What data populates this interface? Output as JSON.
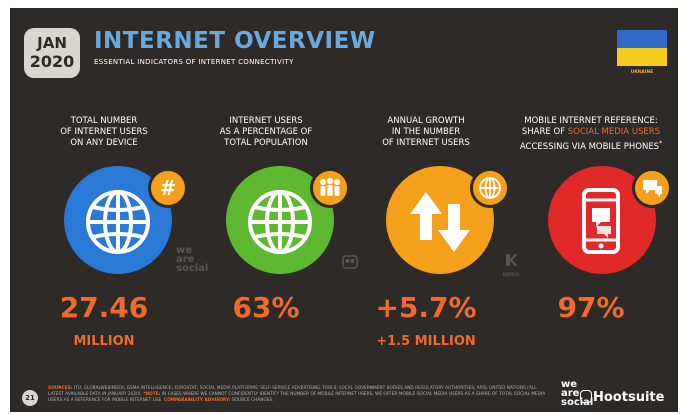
{
  "header": {
    "month": "JAN",
    "year": "2020",
    "title": "INTERNET OVERVIEW",
    "subtitle": "ESSENTIAL INDICATORS OF INTERNET CONNECTIVITY",
    "country": "UKRAINE",
    "flag_colors": [
      "#2f6bc8",
      "#f4cd1c"
    ]
  },
  "metrics": [
    {
      "heading_lines": [
        "TOTAL NUMBER",
        "OF INTERNET USERS",
        "ON ANY DEVICE"
      ],
      "value": "27.46",
      "unit": "MILLION",
      "color": "#2a79d6",
      "icon": "globe-icon",
      "badge_icon": "hashtag-icon"
    },
    {
      "heading_lines": [
        "INTERNET USERS",
        "AS A PERCENTAGE OF",
        "TOTAL POPULATION"
      ],
      "value": "63%",
      "unit": "",
      "color": "#5eb930",
      "icon": "globe-icon",
      "badge_icon": "people-icon"
    },
    {
      "heading_lines": [
        "ANNUAL GROWTH",
        "IN THE NUMBER",
        "OF INTERNET USERS"
      ],
      "value": "+5.7%",
      "unit": "+1.5 MILLION",
      "color": "#f5a01a",
      "icon": "up-down-arrows-icon",
      "badge_icon": "globe-icon"
    },
    {
      "heading_pre": "MOBILE INTERNET REFERENCE:",
      "heading_mid_a": "SHARE OF ",
      "heading_highlight": "SOCIAL MEDIA USERS",
      "heading_last": "ACCESSING VIA MOBILE PHONES",
      "heading_mark": "*",
      "value": "97%",
      "unit": "",
      "color": "#e1292a",
      "icon": "smartphone-icon",
      "badge_icon": "chat-bubbles-icon"
    }
  ],
  "watermarks": {
    "we": "we",
    "are": "are",
    "social": "social",
    "kepios": "KEPIOS"
  },
  "footer": {
    "page": "21",
    "sources_label": "SOURCES:",
    "sources_text": "ITU; GLOBALWEBINDEX; GSMA INTELLIGENCE; EUROSTAT; SOCIAL MEDIA PLATFORMS' SELF-SERVICE ADVERTISING TOOLS; LOCAL GOVERNMENT BODIES AND REGULATORY AUTHORITIES; APIS; UNITED NATIONS (ALL LATEST AVAILABLE DATA IN JANUARY 2020).",
    "note_label": "*NOTE:",
    "note_text": "IN CASES WHERE WE CANNOT CONFIDENTLY IDENTIFY THE NUMBER OF MOBILE INTERNET USERS, WE OFFER MOBILE SOCIAL MEDIA USERS AS A SHARE OF TOTAL SOCIAL MEDIA USERS AS A REFERENCE FOR MOBILE INTERNET USE.",
    "advisory_label": "COMPARABILITY ADVISORY:",
    "advisory_text": "SOURCE CHANGES.",
    "brand_we": "we",
    "brand_are": "are",
    "brand_social": "social",
    "brand_hootsuite": "Hootsuite"
  }
}
